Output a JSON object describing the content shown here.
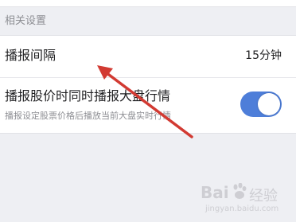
{
  "section": {
    "label": "相关设置"
  },
  "settings": {
    "interval": {
      "title": "播报间隔",
      "value": "15分钟"
    },
    "market_broadcast": {
      "title": "播报股价时同时播报大盘行情",
      "subtitle": "播报设定股票价格后播放当前大盘实时行情",
      "toggle_on": true,
      "toggle_color": "#4e7ed9"
    }
  },
  "annotation": {
    "arrow_color": "#d23a32"
  },
  "watermark": {
    "brand": "Bai",
    "brand_suffix": "经验",
    "url": "jingyan.baidu.com"
  }
}
